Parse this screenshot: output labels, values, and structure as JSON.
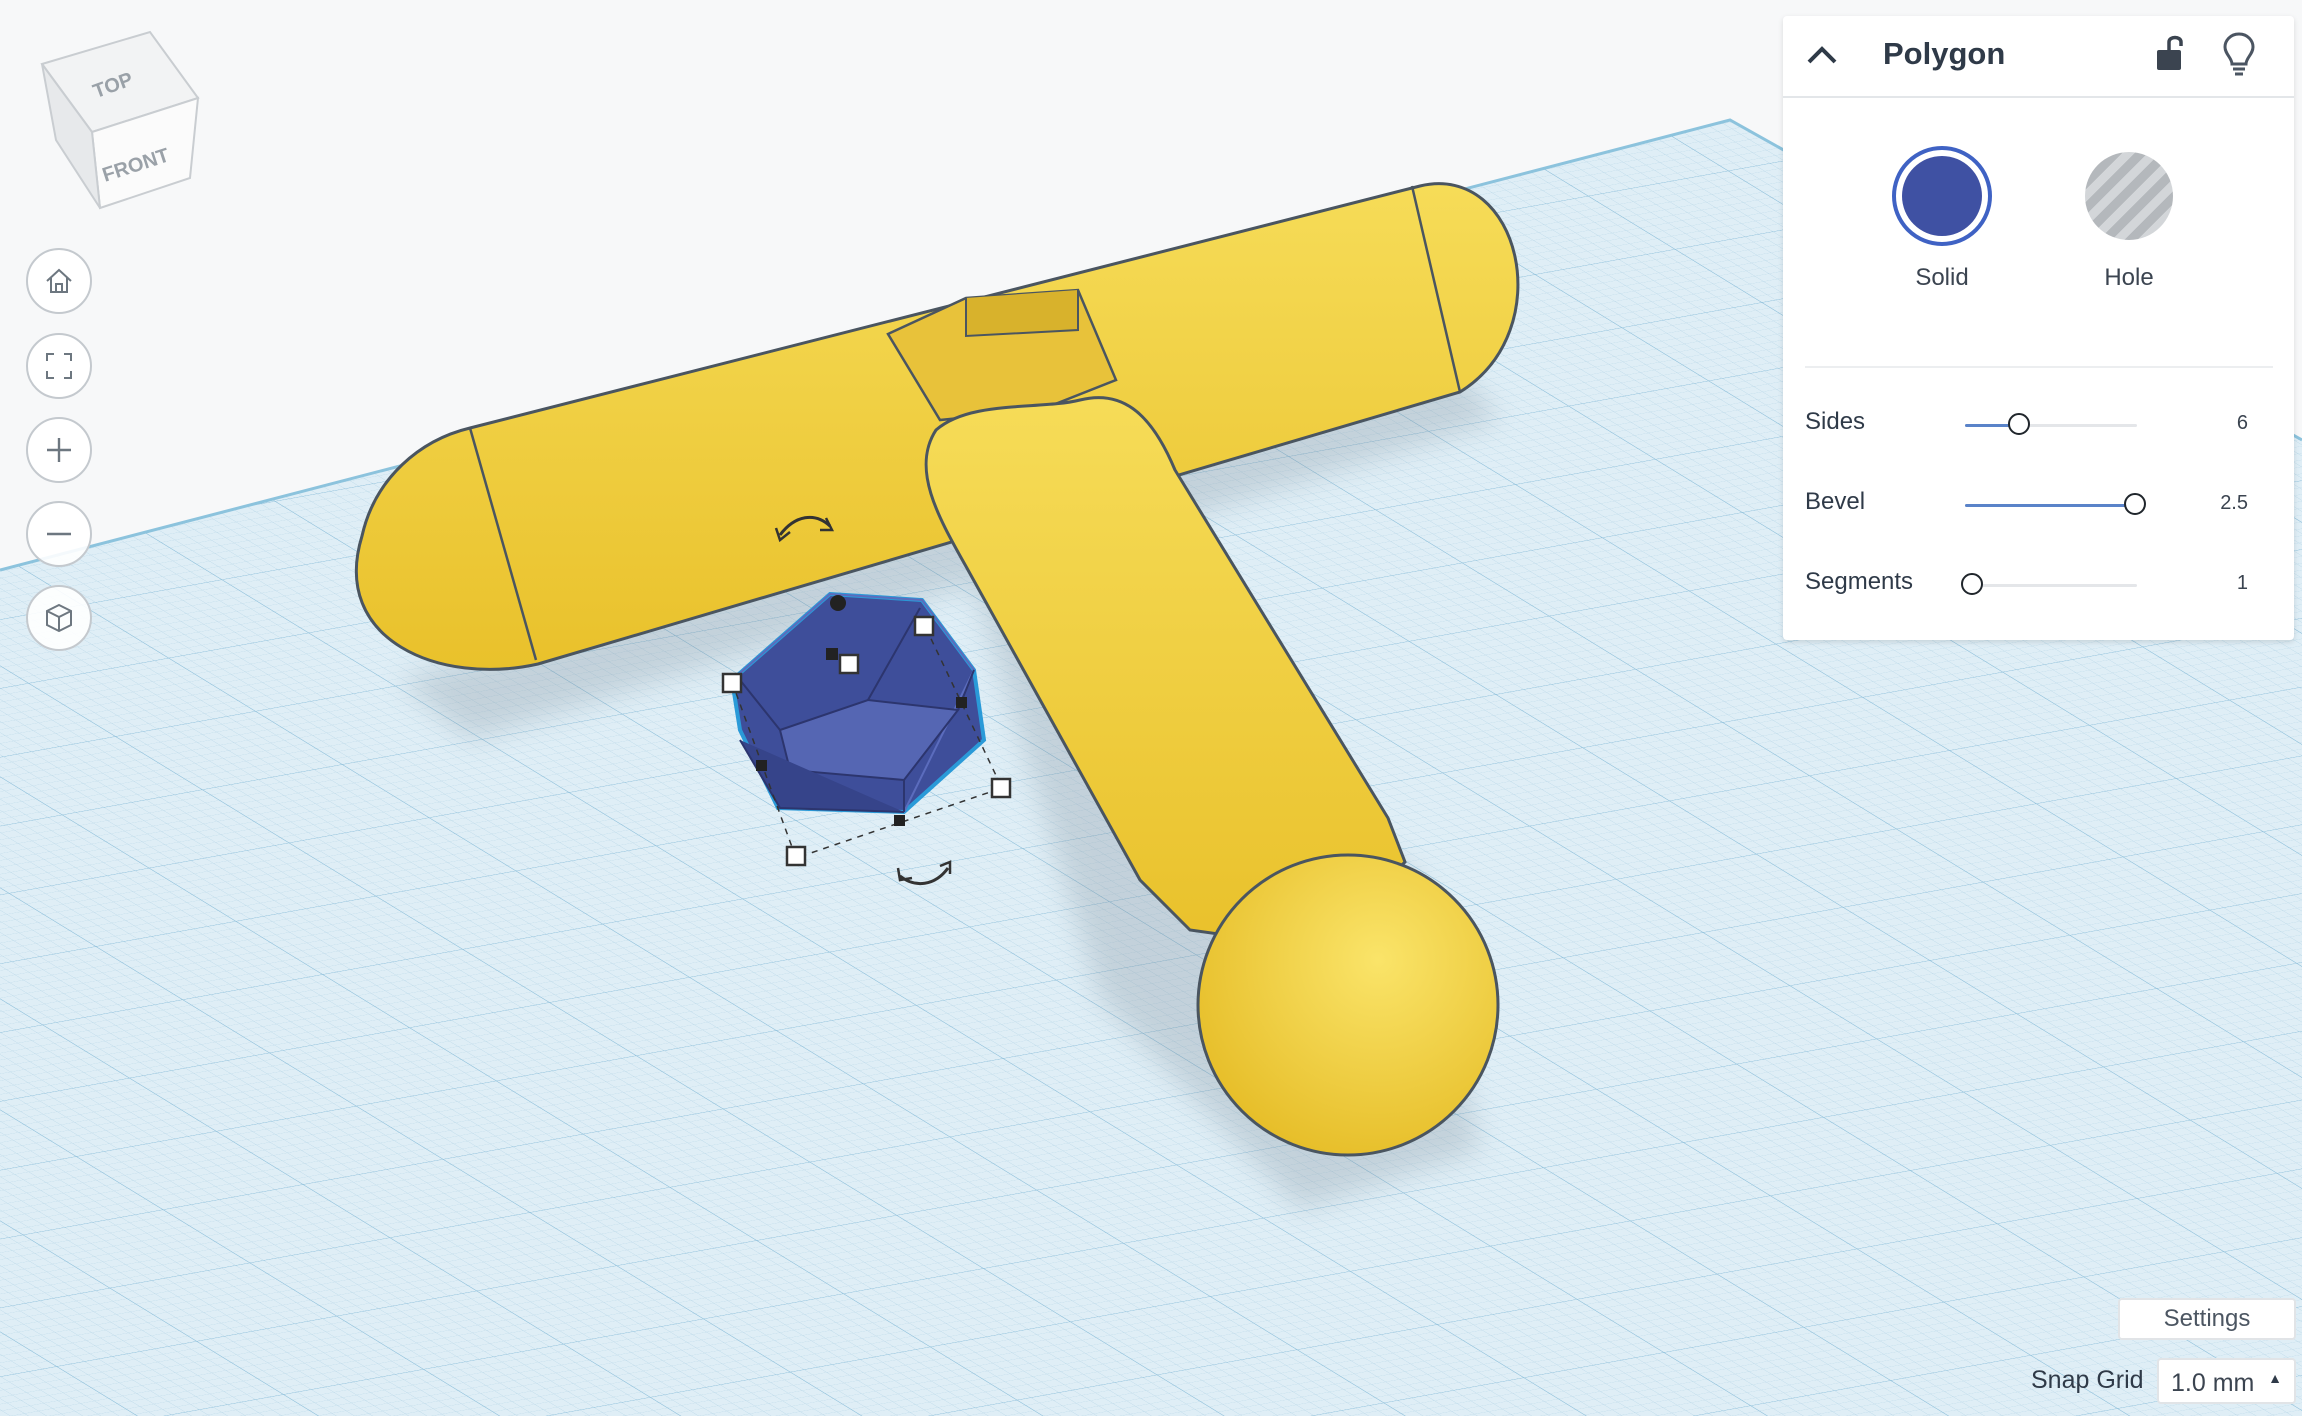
{
  "view_cube": {
    "top_label": "TOP",
    "front_label": "FRONT"
  },
  "nav_buttons": [
    {
      "name": "home",
      "icon": "home-icon"
    },
    {
      "name": "fit",
      "icon": "fit-view-icon"
    },
    {
      "name": "zoom-in",
      "icon": "plus-icon"
    },
    {
      "name": "zoom-out",
      "icon": "minus-icon"
    },
    {
      "name": "perspective",
      "icon": "cube-icon"
    }
  ],
  "inspector": {
    "title": "Polygon",
    "solid_label": "Solid",
    "hole_label": "Hole",
    "solid_color": "#3f51a3",
    "params": [
      {
        "label": "Sides",
        "value": "6",
        "fraction": 0.21
      },
      {
        "label": "Bevel",
        "value": "2.5",
        "fraction": 0.98
      },
      {
        "label": "Segments",
        "value": "1",
        "fraction": 0.0
      }
    ]
  },
  "settings_label": "Settings",
  "snap_grid": {
    "label": "Snap Grid",
    "value": "1.0 mm"
  },
  "colors": {
    "shape_yellow": "#f5d547",
    "shape_blue": "#4a5aa8",
    "grid_bg": "#dcecf5",
    "grid_line": "#a9cce0"
  }
}
